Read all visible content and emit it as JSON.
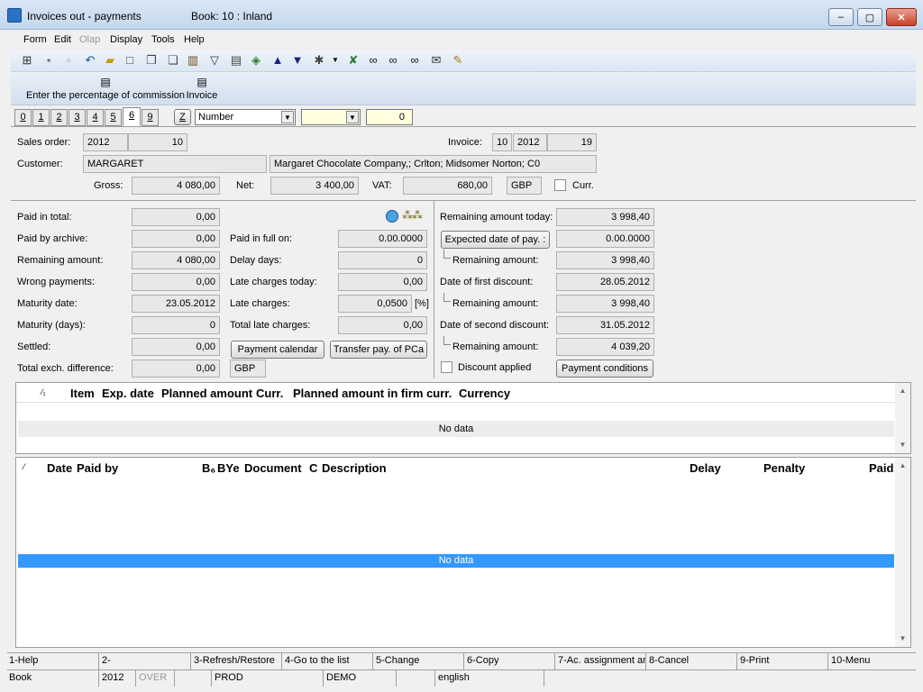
{
  "window": {
    "title": "Invoices out - payments",
    "book": "Book: 10 : Inland",
    "minimize": "–",
    "maximize": "▢",
    "close": "✕"
  },
  "menu": [
    "Form",
    "Edit",
    "Olap",
    "Display",
    "Tools",
    "Help"
  ],
  "actions": {
    "commission": "Enter the percentage of commission",
    "invoice": "Invoice"
  },
  "tabs": [
    "0",
    "1",
    "2",
    "3",
    "4",
    "5",
    "6",
    "9"
  ],
  "filter": {
    "z_label": "Z",
    "sort_select": "Number",
    "search_value": "",
    "count_value": "0"
  },
  "header": {
    "sales_order_label": "Sales order:",
    "sales_order_year": "2012",
    "sales_order_number": "10",
    "invoice_label": "Invoice:",
    "invoice_book": "10",
    "invoice_year": "2012",
    "invoice_number": "19",
    "customer_label": "Customer:",
    "customer_code": "MARGARET",
    "customer_name": "Margaret Chocolate Company,; Crlton; Midsomer Norton; C0",
    "gross_label": "Gross:",
    "gross_value": "4 080,00",
    "net_label": "Net:",
    "net_value": "3 400,00",
    "vat_label": "VAT:",
    "vat_value": "680,00",
    "currency": "GBP",
    "curr_label": "Curr."
  },
  "left": {
    "paid_in_total_label": "Paid in total:",
    "paid_in_total": "0,00",
    "paid_by_archive_label": "Paid by archive:",
    "paid_by_archive": "0,00",
    "remaining_amount_label": "Remaining amount:",
    "remaining_amount": "4 080,00",
    "wrong_payments_label": "Wrong payments:",
    "wrong_payments": "0,00",
    "maturity_date_label": "Maturity date:",
    "maturity_date": "23.05.2012",
    "maturity_days_label": "Maturity (days):",
    "maturity_days": "0",
    "settled_label": "Settled:",
    "settled": "0,00",
    "total_exch_label": "Total exch. difference:",
    "total_exch": "0,00",
    "total_exch_curr": "GBP"
  },
  "middle": {
    "paid_in_full_label": "Paid in full on:",
    "paid_in_full": "0.00.0000",
    "delay_days_label": "Delay days:",
    "delay_days": "0",
    "late_today_label": "Late charges today:",
    "late_today": "0,00",
    "late_charges_label": "Late charges:",
    "late_charges": "0,0500",
    "late_charges_unit": "[%]",
    "total_late_label": "Total late charges:",
    "total_late": "0,00",
    "payment_calendar_btn": "Payment calendar",
    "transfer_btn": "Transfer pay. of PCa"
  },
  "right": {
    "remaining_today_label": "Remaining amount today:",
    "remaining_today": "3 998,40",
    "expected_date_btn": "Expected date of pay. :",
    "expected_date": "0.00.0000",
    "remaining1_label": "Remaining amount:",
    "remaining1": "3 998,40",
    "first_discount_label": "Date of first discount:",
    "first_discount": "28.05.2012",
    "remaining2_label": "Remaining amount:",
    "remaining2": "3 998,40",
    "second_discount_label": "Date of second discount:",
    "second_discount": "31.05.2012",
    "remaining3_label": "Remaining amount:",
    "remaining3": "4 039,20",
    "discount_applied_label": "Discount applied",
    "payment_conditions_btn": "Payment conditions"
  },
  "grid1": {
    "sort_marker": "⁄₁",
    "columns": [
      "Item",
      "Exp. date",
      "Planned amount",
      "Curr.",
      "Planned amount in firm curr.",
      "Currency"
    ],
    "empty_text": "No data"
  },
  "grid2": {
    "sort_marker": "⁄",
    "columns": [
      "Date",
      "Paid by",
      "B₆",
      "BYe",
      "Document",
      "C",
      "Description",
      "Delay",
      "Penalty",
      "Paid"
    ],
    "empty_text": "No data"
  },
  "fkeys": [
    "1-Help",
    "2-",
    "3-Refresh/Restore",
    "4-Go to the list",
    "5-Change",
    "6-Copy",
    "7-Ac. assignment an",
    "8-Cancel",
    "9-Print",
    "10-Menu"
  ],
  "status": [
    "Book",
    "2012",
    "OVER",
    "PROD",
    "DEMO",
    "english"
  ],
  "colors": {
    "selection": "#3399ff",
    "titlebar": "#c4d8ee"
  }
}
